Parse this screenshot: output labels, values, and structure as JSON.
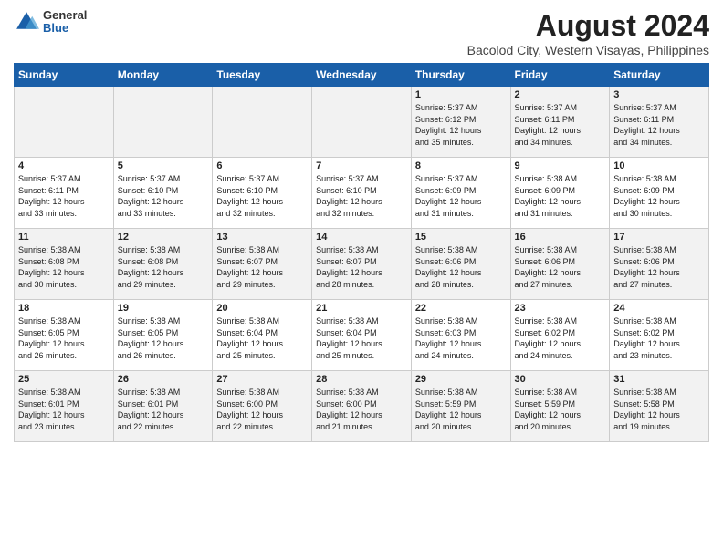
{
  "header": {
    "logo_general": "General",
    "logo_blue": "Blue",
    "main_title": "August 2024",
    "subtitle": "Bacolod City, Western Visayas, Philippines"
  },
  "days_of_week": [
    "Sunday",
    "Monday",
    "Tuesday",
    "Wednesday",
    "Thursday",
    "Friday",
    "Saturday"
  ],
  "weeks": [
    [
      {
        "day": "",
        "text": ""
      },
      {
        "day": "",
        "text": ""
      },
      {
        "day": "",
        "text": ""
      },
      {
        "day": "",
        "text": ""
      },
      {
        "day": "1",
        "text": "Sunrise: 5:37 AM\nSunset: 6:12 PM\nDaylight: 12 hours\nand 35 minutes."
      },
      {
        "day": "2",
        "text": "Sunrise: 5:37 AM\nSunset: 6:11 PM\nDaylight: 12 hours\nand 34 minutes."
      },
      {
        "day": "3",
        "text": "Sunrise: 5:37 AM\nSunset: 6:11 PM\nDaylight: 12 hours\nand 34 minutes."
      }
    ],
    [
      {
        "day": "4",
        "text": "Sunrise: 5:37 AM\nSunset: 6:11 PM\nDaylight: 12 hours\nand 33 minutes."
      },
      {
        "day": "5",
        "text": "Sunrise: 5:37 AM\nSunset: 6:10 PM\nDaylight: 12 hours\nand 33 minutes."
      },
      {
        "day": "6",
        "text": "Sunrise: 5:37 AM\nSunset: 6:10 PM\nDaylight: 12 hours\nand 32 minutes."
      },
      {
        "day": "7",
        "text": "Sunrise: 5:37 AM\nSunset: 6:10 PM\nDaylight: 12 hours\nand 32 minutes."
      },
      {
        "day": "8",
        "text": "Sunrise: 5:37 AM\nSunset: 6:09 PM\nDaylight: 12 hours\nand 31 minutes."
      },
      {
        "day": "9",
        "text": "Sunrise: 5:38 AM\nSunset: 6:09 PM\nDaylight: 12 hours\nand 31 minutes."
      },
      {
        "day": "10",
        "text": "Sunrise: 5:38 AM\nSunset: 6:09 PM\nDaylight: 12 hours\nand 30 minutes."
      }
    ],
    [
      {
        "day": "11",
        "text": "Sunrise: 5:38 AM\nSunset: 6:08 PM\nDaylight: 12 hours\nand 30 minutes."
      },
      {
        "day": "12",
        "text": "Sunrise: 5:38 AM\nSunset: 6:08 PM\nDaylight: 12 hours\nand 29 minutes."
      },
      {
        "day": "13",
        "text": "Sunrise: 5:38 AM\nSunset: 6:07 PM\nDaylight: 12 hours\nand 29 minutes."
      },
      {
        "day": "14",
        "text": "Sunrise: 5:38 AM\nSunset: 6:07 PM\nDaylight: 12 hours\nand 28 minutes."
      },
      {
        "day": "15",
        "text": "Sunrise: 5:38 AM\nSunset: 6:06 PM\nDaylight: 12 hours\nand 28 minutes."
      },
      {
        "day": "16",
        "text": "Sunrise: 5:38 AM\nSunset: 6:06 PM\nDaylight: 12 hours\nand 27 minutes."
      },
      {
        "day": "17",
        "text": "Sunrise: 5:38 AM\nSunset: 6:06 PM\nDaylight: 12 hours\nand 27 minutes."
      }
    ],
    [
      {
        "day": "18",
        "text": "Sunrise: 5:38 AM\nSunset: 6:05 PM\nDaylight: 12 hours\nand 26 minutes."
      },
      {
        "day": "19",
        "text": "Sunrise: 5:38 AM\nSunset: 6:05 PM\nDaylight: 12 hours\nand 26 minutes."
      },
      {
        "day": "20",
        "text": "Sunrise: 5:38 AM\nSunset: 6:04 PM\nDaylight: 12 hours\nand 25 minutes."
      },
      {
        "day": "21",
        "text": "Sunrise: 5:38 AM\nSunset: 6:04 PM\nDaylight: 12 hours\nand 25 minutes."
      },
      {
        "day": "22",
        "text": "Sunrise: 5:38 AM\nSunset: 6:03 PM\nDaylight: 12 hours\nand 24 minutes."
      },
      {
        "day": "23",
        "text": "Sunrise: 5:38 AM\nSunset: 6:02 PM\nDaylight: 12 hours\nand 24 minutes."
      },
      {
        "day": "24",
        "text": "Sunrise: 5:38 AM\nSunset: 6:02 PM\nDaylight: 12 hours\nand 23 minutes."
      }
    ],
    [
      {
        "day": "25",
        "text": "Sunrise: 5:38 AM\nSunset: 6:01 PM\nDaylight: 12 hours\nand 23 minutes."
      },
      {
        "day": "26",
        "text": "Sunrise: 5:38 AM\nSunset: 6:01 PM\nDaylight: 12 hours\nand 22 minutes."
      },
      {
        "day": "27",
        "text": "Sunrise: 5:38 AM\nSunset: 6:00 PM\nDaylight: 12 hours\nand 22 minutes."
      },
      {
        "day": "28",
        "text": "Sunrise: 5:38 AM\nSunset: 6:00 PM\nDaylight: 12 hours\nand 21 minutes."
      },
      {
        "day": "29",
        "text": "Sunrise: 5:38 AM\nSunset: 5:59 PM\nDaylight: 12 hours\nand 20 minutes."
      },
      {
        "day": "30",
        "text": "Sunrise: 5:38 AM\nSunset: 5:59 PM\nDaylight: 12 hours\nand 20 minutes."
      },
      {
        "day": "31",
        "text": "Sunrise: 5:38 AM\nSunset: 5:58 PM\nDaylight: 12 hours\nand 19 minutes."
      }
    ]
  ]
}
